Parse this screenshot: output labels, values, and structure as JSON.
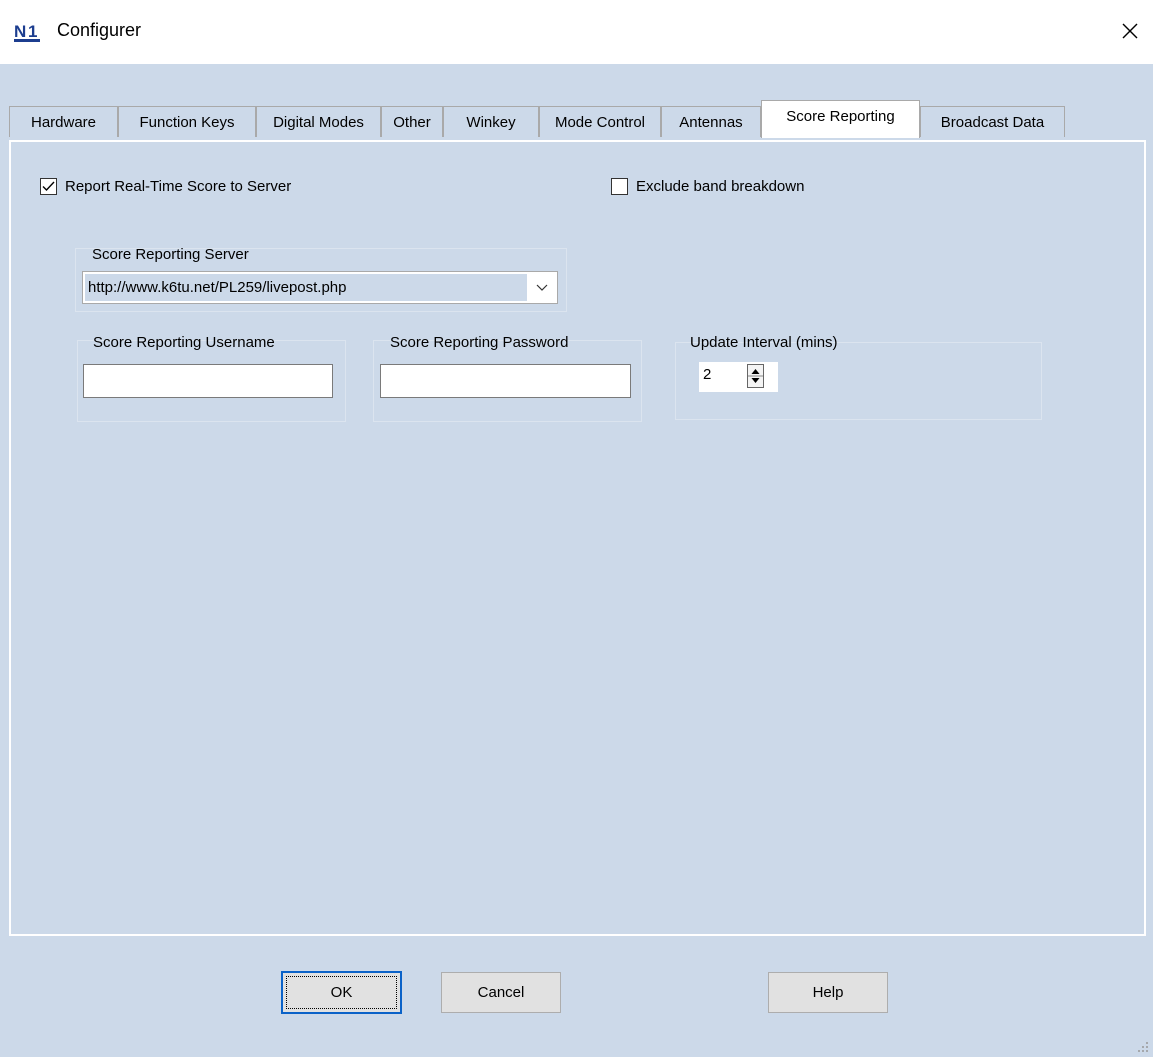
{
  "window": {
    "title": "Configurer",
    "icon": "n1mm-logo-icon",
    "close_icon": "close-icon"
  },
  "tabs": [
    {
      "label": "Hardware",
      "active": false
    },
    {
      "label": "Function Keys",
      "active": false
    },
    {
      "label": "Digital Modes",
      "active": false
    },
    {
      "label": "Other",
      "active": false
    },
    {
      "label": "Winkey",
      "active": false
    },
    {
      "label": "Mode Control",
      "active": false
    },
    {
      "label": "Antennas",
      "active": false
    },
    {
      "label": "Score Reporting",
      "active": true
    },
    {
      "label": "Broadcast Data",
      "active": false
    }
  ],
  "score_reporting": {
    "report_realtime": {
      "label": "Report Real-Time Score to Server",
      "checked": true
    },
    "exclude_band": {
      "label": "Exclude band breakdown",
      "checked": false
    },
    "server": {
      "label": "Score Reporting Server",
      "value": "http://www.k6tu.net/PL259/livepost.php"
    },
    "username": {
      "label": "Score Reporting Username",
      "value": ""
    },
    "password": {
      "label": "Score Reporting Password",
      "value": ""
    },
    "interval": {
      "label": "Update Interval (mins)",
      "value": "2"
    }
  },
  "buttons": {
    "ok": "OK",
    "cancel": "Cancel",
    "help": "Help"
  },
  "colors": {
    "background": "#ccd9e9",
    "titlebar": "#ffffff",
    "default_button_border": "#0a62c8"
  }
}
